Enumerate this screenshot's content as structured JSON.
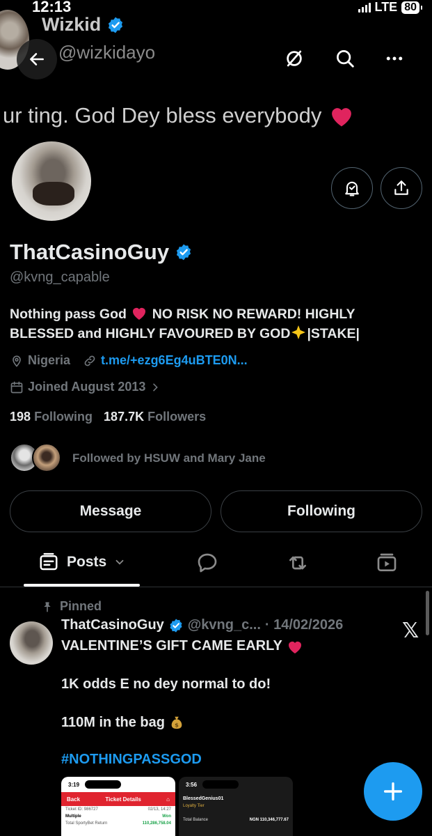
{
  "status_bar": {
    "time": "12:13",
    "network": "LTE",
    "battery": "80"
  },
  "background_header": {
    "name": "Wizkid",
    "handle": "@wizkidayo",
    "tweet_fragment": "ur ting. God Dey bless everybody"
  },
  "profile": {
    "display_name": "ThatCasinoGuy",
    "username": "@kvng_capable",
    "bio_line1": "Nothing pass God",
    "bio_line1_b": "NO RISK NO REWARD! HIGHLY",
    "bio_line2": "BLESSED and HIGHLY FAVOURED BY GOD",
    "bio_line2_b": "|STAKE|",
    "location": "Nigeria",
    "link": "t.me/+ezg6Eg4uBTE0N...",
    "joined": "Joined August 2013",
    "following_count": "198",
    "following_label": "Following",
    "followers_count": "187.7K",
    "followers_label": "Followers",
    "followed_by": "Followed by HSUW and Mary Jane"
  },
  "actions": {
    "message": "Message",
    "following": "Following"
  },
  "tabs": {
    "posts": "Posts"
  },
  "pinned_post": {
    "pinned_label": "Pinned",
    "author": "ThatCasinoGuy",
    "handle": "@kvng_c...",
    "date": "· 14/02/2026",
    "line1": "VALENTINE’S GIFT CAME EARLY",
    "line2": "1K odds E no dey normal to do!",
    "line3": "110M in the bag",
    "hashtag": "#NOTHINGPASSGOD",
    "x_logo": "𝕏",
    "media": [
      {
        "time": "3:19",
        "back": "Back",
        "title": "Ticket Details",
        "ticket": "Ticket ID: 986727",
        "ticket_date": "02/13, 14:27",
        "type": "Multiple",
        "status": "Won",
        "return_label": "Total SportyBet Return",
        "return_value": "110,286,758.04"
      },
      {
        "time": "3:56",
        "user": "BlessedGenius01",
        "tier": "Loyalty Tier",
        "balance_label": "Total Balance",
        "balance_value": "NGN 110,346,777.67"
      }
    ]
  },
  "colors": {
    "accent": "#1d9bf0",
    "background": "#000000",
    "muted": "#71767b",
    "heart": "#e0245e"
  }
}
